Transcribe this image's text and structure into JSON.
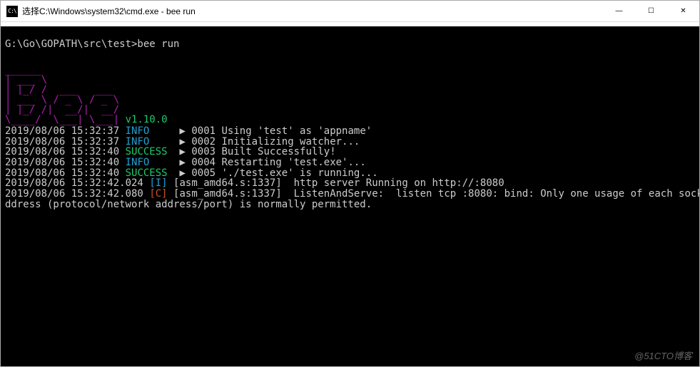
{
  "titlebar": {
    "icon_glyph": "C:\\",
    "text": "选择C:\\Windows\\system32\\cmd.exe - bee  run",
    "minimize": "—",
    "maximize": "☐",
    "close": "✕"
  },
  "terminal": {
    "prompt": "G:\\Go\\GOPATH\\src\\test>bee run",
    "ascii": [
      "______",
      "| ___ \\",
      "| |_/ /  ___   ___",
      "| ___ \\ / _ \\ / _ \\",
      "| |_/ /|  __/|  __/",
      "\\____/  \\___| \\___| "
    ],
    "version": "v1.10.0",
    "logs": [
      {
        "ts": "2019/08/06 15:32:37",
        "level": "INFO",
        "arrow": "▶",
        "msg": "0001 Using 'test' as 'appname'"
      },
      {
        "ts": "2019/08/06 15:32:37",
        "level": "INFO",
        "arrow": "▶",
        "msg": "0002 Initializing watcher..."
      },
      {
        "ts": "2019/08/06 15:32:40",
        "level": "SUCCESS",
        "arrow": "▶",
        "msg": "0003 Built Successfully!"
      },
      {
        "ts": "2019/08/06 15:32:40",
        "level": "INFO",
        "arrow": "▶",
        "msg": "0004 Restarting 'test.exe'..."
      },
      {
        "ts": "2019/08/06 15:32:40",
        "level": "SUCCESS",
        "arrow": "▶",
        "msg": "0005 './test.exe' is running..."
      }
    ],
    "plain_logs": [
      {
        "ts": "2019/08/06 15:32:42.024",
        "tag": "[I]",
        "tagclass": "i-tag",
        "rest": "[asm_amd64.s:1337]  http server Running on http://:8080"
      },
      {
        "ts": "2019/08/06 15:32:42.080",
        "tag": "[C]",
        "tagclass": "c-tag",
        "rest": "[asm_amd64.s:1337]  ListenAndServe:  listen tcp :8080: bind: Only one usage of each socket a"
      }
    ],
    "wrap_line": "ddress (protocol/network address/port) is normally permitted."
  },
  "watermark": "@51CTO博客"
}
